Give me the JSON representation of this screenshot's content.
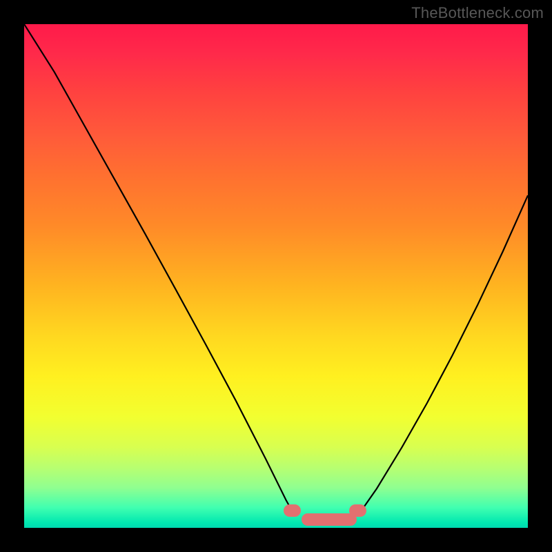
{
  "watermark": "TheBottleneck.com",
  "chart_data": {
    "type": "line",
    "title": "",
    "xlabel": "",
    "ylabel": "",
    "xlim": [
      0,
      100
    ],
    "ylim": [
      0,
      100
    ],
    "grid": false,
    "series": [
      {
        "name": "left-curve",
        "x": [
          0,
          6,
          12,
          18,
          24,
          30,
          36,
          42,
          48,
          52,
          53.5
        ],
        "y": [
          100,
          90.5,
          79.8,
          69.1,
          58.4,
          47.5,
          36.5,
          25.3,
          13.6,
          5.5,
          2.8
        ]
      },
      {
        "name": "right-curve",
        "x": [
          66.5,
          70,
          75,
          80,
          85,
          90,
          95,
          100
        ],
        "y": [
          2.8,
          7.8,
          16.0,
          24.8,
          34.2,
          44.2,
          54.8,
          66.0
        ]
      }
    ],
    "annotations": [
      {
        "name": "flat-pink-band",
        "x_start": 55,
        "x_end": 66,
        "y": 1.7
      },
      {
        "name": "left-pink-cap",
        "x_start": 51.5,
        "x_end": 55,
        "y": 3.4
      },
      {
        "name": "right-pink-cap",
        "x_start": 64.5,
        "x_end": 68,
        "y": 3.4
      }
    ],
    "background_gradient": {
      "direction": "vertical",
      "stops": [
        {
          "pos": 0.0,
          "color": "#ff1a4a"
        },
        {
          "pos": 0.5,
          "color": "#ffd020"
        },
        {
          "pos": 0.85,
          "color": "#d8ff50"
        },
        {
          "pos": 1.0,
          "color": "#00d8b0"
        }
      ]
    }
  }
}
